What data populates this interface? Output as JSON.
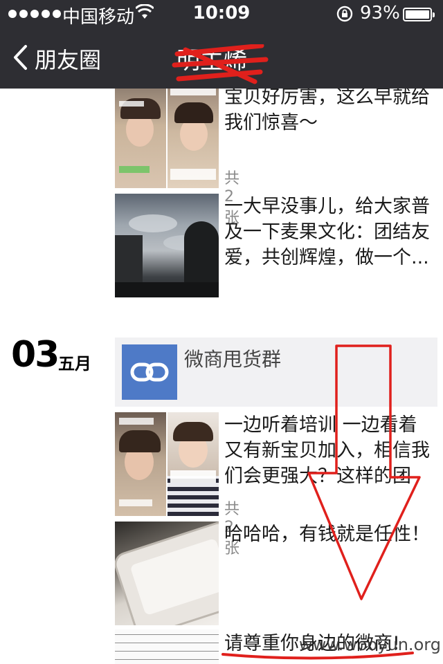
{
  "statusbar": {
    "carrier": "中国移动",
    "time": "10:09",
    "battery_pct": "93%"
  },
  "nav": {
    "back_label": "朋友圈",
    "title": "明主烯"
  },
  "posts": [
    {
      "text": "宝贝好厉害，这么早就给我们惊喜～",
      "count": "共2张",
      "thumb": "chat-screenshots"
    },
    {
      "text": "一大早没事儿，给大家普及一下麦果文化：团结友爱，共创辉煌，做一个...",
      "thumb": "cloudy-sky-photo"
    },
    {
      "text": "一边听着培训  一边看着又有新宝贝加入，相信我们会更强大？这样的团",
      "count": "共2张",
      "thumb": "chat-screenshots"
    },
    {
      "text": "哈哈哈，有钱就是任性！",
      "thumb": "phone-photo"
    },
    {
      "text": "请尊重你身边的微商!",
      "thumb": "text-document"
    }
  ],
  "date_group": {
    "day": "03",
    "month": "五月"
  },
  "shared_link": {
    "title": "微商甩货群",
    "icon": "link-icon"
  },
  "watermark": "www.wooyun.org",
  "colors": {
    "topbar": "#2e2e33",
    "share_icon_bg": "#4e7ac7",
    "annotation_red": "#e0201c"
  }
}
